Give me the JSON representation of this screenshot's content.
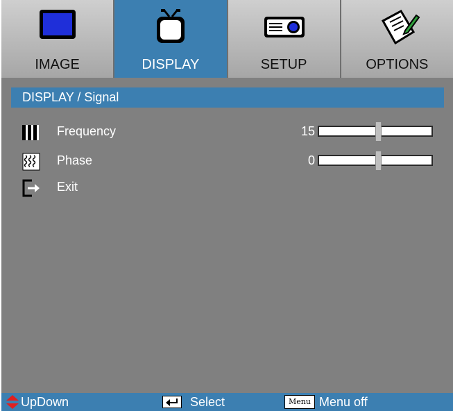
{
  "tabs": [
    {
      "label": "IMAGE",
      "icon": "monitor-icon",
      "active": false
    },
    {
      "label": "DISPLAY",
      "icon": "tv-icon",
      "active": true
    },
    {
      "label": "SETUP",
      "icon": "projector-icon",
      "active": false
    },
    {
      "label": "OPTIONS",
      "icon": "notepad-pencil-icon",
      "active": false
    }
  ],
  "header": {
    "title": "DISPLAY / Signal"
  },
  "rows": {
    "frequency": {
      "label": "Frequency",
      "value": "15",
      "icon": "frequency-bars-icon",
      "slider_fraction": 0.53
    },
    "phase": {
      "label": "Phase",
      "value": "0",
      "icon": "phase-wave-icon",
      "slider_fraction": 0.53
    },
    "exit": {
      "label": "Exit",
      "icon": "exit-arrow-icon"
    }
  },
  "footer": {
    "updown": {
      "label": "UpDown",
      "icon": "up-down-arrows-icon"
    },
    "select": {
      "label": "Select",
      "icon": "enter-key-icon"
    },
    "menu": {
      "label": "Menu off",
      "key_label": "Menu",
      "icon": "menu-key-icon"
    }
  },
  "colors": {
    "accent": "#3c7fb1",
    "panel": "#808080",
    "tab": "#b5b5b5",
    "updown_arrow": "#e02020"
  }
}
